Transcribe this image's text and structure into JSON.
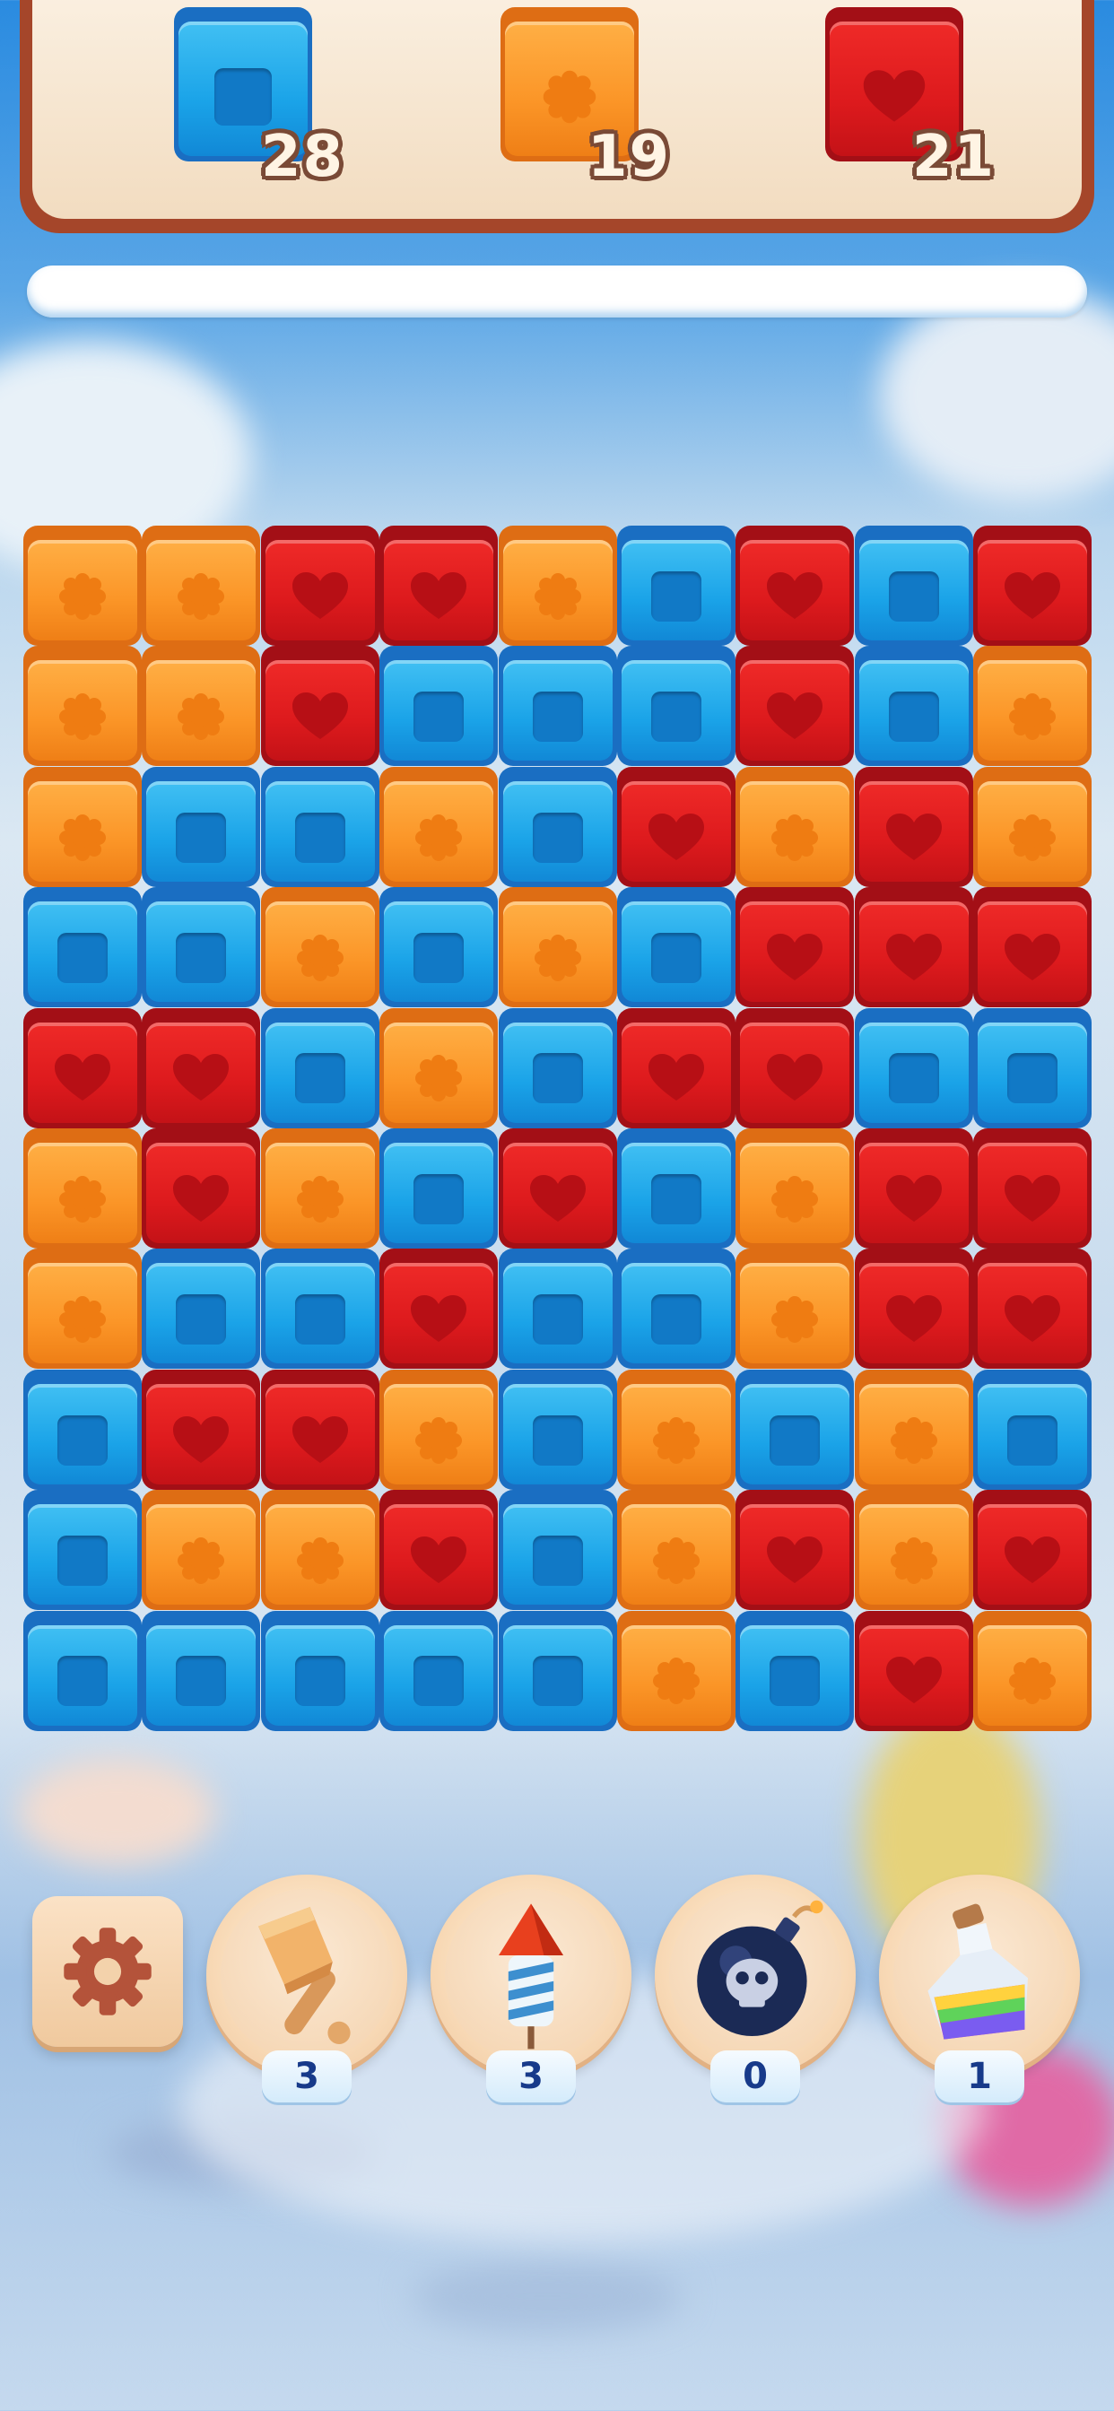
{
  "goals": [
    {
      "type": "blue",
      "symbol": "square",
      "count": "28"
    },
    {
      "type": "orange",
      "symbol": "flower",
      "count": "19"
    },
    {
      "type": "red",
      "symbol": "heart",
      "count": "21"
    }
  ],
  "progress": 0,
  "colors": {
    "blue": "#1aa3e8",
    "orange": "#fb9527",
    "red": "#dd1a1d"
  },
  "board": {
    "rows": [
      [
        "O",
        "O",
        "R",
        "R",
        "O",
        "B",
        "R",
        "B",
        "R"
      ],
      [
        "O",
        "O",
        "R",
        "B",
        "B",
        "B",
        "R",
        "B",
        "O"
      ],
      [
        "O",
        "B",
        "B",
        "O",
        "B",
        "R",
        "O",
        "R",
        "O"
      ],
      [
        "B",
        "B",
        "O",
        "B",
        "O",
        "B",
        "R",
        "R",
        "R"
      ],
      [
        "R",
        "R",
        "B",
        "O",
        "B",
        "R",
        "R",
        "B",
        "B"
      ],
      [
        "O",
        "R",
        "O",
        "B",
        "R",
        "B",
        "O",
        "R",
        "R"
      ],
      [
        "O",
        "B",
        "B",
        "R",
        "B",
        "B",
        "O",
        "R",
        "R"
      ],
      [
        "B",
        "R",
        "R",
        "O",
        "B",
        "O",
        "B",
        "O",
        "B"
      ],
      [
        "B",
        "O",
        "O",
        "R",
        "B",
        "O",
        "R",
        "O",
        "R"
      ],
      [
        "B",
        "B",
        "B",
        "B",
        "B",
        "O",
        "B",
        "R",
        "O"
      ]
    ]
  },
  "boosters": [
    {
      "name": "hammer",
      "icon": "hammer-icon",
      "count": "3"
    },
    {
      "name": "rocket",
      "icon": "rocket-icon",
      "count": "3"
    },
    {
      "name": "bomb",
      "icon": "bomb-icon",
      "count": "0"
    },
    {
      "name": "potion",
      "icon": "potion-icon",
      "count": "1"
    }
  ],
  "settings": {
    "icon": "gear-icon"
  }
}
